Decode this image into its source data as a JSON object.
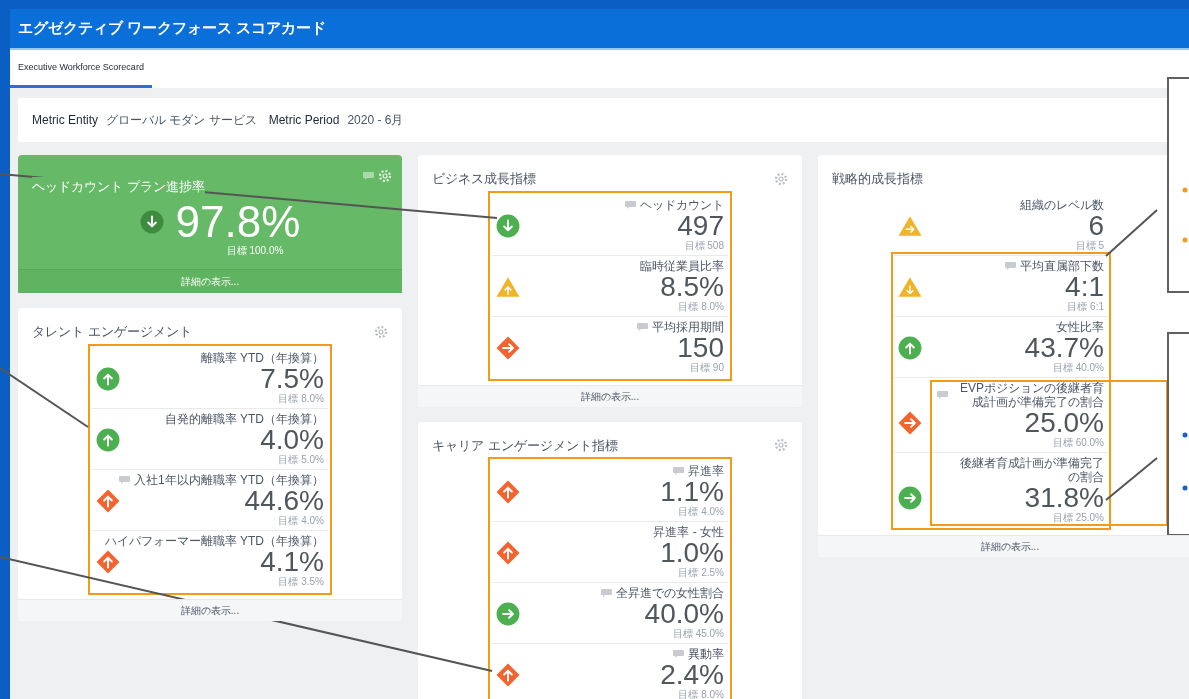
{
  "window": {
    "title": "エグゼクティブ ワークフォース スコアカード"
  },
  "tabs": [
    {
      "label": "Executive Workforce Scorecard",
      "selected": true
    }
  ],
  "filters": [
    {
      "label": "Metric Entity",
      "value": "グローバル モダン サービス"
    },
    {
      "label": "Metric Period",
      "value": "2020 - 6月"
    }
  ],
  "columns": [
    [
      {
        "kind": "highlight",
        "title": "ヘッドカウント プラン進捗率",
        "comment": true,
        "icon": {
          "kind": "circle",
          "color": "#3e8a3e"
        },
        "arrow": {
          "kind": "down"
        },
        "value": "97.8%",
        "target": "目標 100.0%",
        "link": "詳細の表示..."
      },
      {
        "kind": "list",
        "title": "タレント エンゲージメント",
        "link": "詳細の表示...",
        "metrics": [
          {
            "label": "離職率 YTD（年換算）",
            "comment": false,
            "icon": {
              "kind": "circle",
              "color": "#4caf50"
            },
            "arrow": {
              "kind": "up"
            },
            "value": "7.5%",
            "target": "目標 8.0%"
          },
          {
            "label": "自発的離職率 YTD（年換算）",
            "comment": false,
            "icon": {
              "kind": "circle",
              "color": "#4caf50"
            },
            "arrow": {
              "kind": "up"
            },
            "value": "4.0%",
            "target": "目標 5.0%"
          },
          {
            "label": "入社1年以内離職率 YTD（年換算）",
            "comment": true,
            "icon": {
              "kind": "diamond",
              "color": "#f4622e"
            },
            "arrow": {
              "kind": "up"
            },
            "value": "44.6%",
            "target": "目標 4.0%"
          },
          {
            "label": "ハイパフォーマー離職率 YTD（年換算）",
            "comment": false,
            "icon": {
              "kind": "diamond",
              "color": "#f4622e"
            },
            "arrow": {
              "kind": "up"
            },
            "value": "4.1%",
            "target": "目標 3.5%"
          }
        ]
      }
    ],
    [
      {
        "kind": "list",
        "title": "ビジネス成長指標",
        "link": "詳細の表示...",
        "metrics": [
          {
            "label": "ヘッドカウント",
            "comment": true,
            "icon": {
              "kind": "circle",
              "color": "#4caf50"
            },
            "arrow": {
              "kind": "down"
            },
            "value": "497",
            "target": "目標 508"
          },
          {
            "label": "臨時従業員比率",
            "comment": false,
            "icon": {
              "kind": "triangle",
              "color": "#f0b429"
            },
            "arrow": {
              "kind": "up"
            },
            "value": "8.5%",
            "target": "目標 8.0%"
          },
          {
            "label": "平均採用期間",
            "comment": true,
            "icon": {
              "kind": "diamond",
              "color": "#f4622e"
            },
            "arrow": {
              "kind": "right"
            },
            "value": "150",
            "target": "目標 90"
          }
        ]
      },
      {
        "kind": "list",
        "title": "キャリア エンゲージメント指標",
        "metrics": [
          {
            "label": "昇進率",
            "comment": true,
            "icon": {
              "kind": "diamond",
              "color": "#f4622e"
            },
            "arrow": {
              "kind": "up"
            },
            "value": "1.1%",
            "target": "目標 4.0%"
          },
          {
            "label": "昇進率 - 女性",
            "comment": false,
            "icon": {
              "kind": "diamond",
              "color": "#f4622e"
            },
            "arrow": {
              "kind": "up"
            },
            "value": "1.0%",
            "target": "目標 2.5%"
          },
          {
            "label": "全昇進での女性割合",
            "comment": true,
            "icon": {
              "kind": "circle",
              "color": "#4caf50"
            },
            "arrow": {
              "kind": "right"
            },
            "value": "40.0%",
            "target": "目標 45.0%"
          },
          {
            "label": "異動率",
            "comment": true,
            "icon": {
              "kind": "diamond",
              "color": "#f4622e"
            },
            "arrow": {
              "kind": "up"
            },
            "value": "2.4%",
            "target": "目標 8.0%"
          }
        ]
      }
    ],
    [
      {
        "kind": "list",
        "title": "戦略的成長指標",
        "link": "詳細の表示...",
        "metrics": [
          {
            "label": "組織のレベル数",
            "comment": false,
            "icon": {
              "kind": "triangle",
              "color": "#f0b429"
            },
            "arrow": {
              "kind": "right"
            },
            "value": "6",
            "target": "目標 5"
          },
          {
            "label": "平均直属部下数",
            "comment": true,
            "icon": {
              "kind": "triangle",
              "color": "#f0b429"
            },
            "arrow": {
              "kind": "down"
            },
            "value": "4:1",
            "target": "目標 6:1"
          },
          {
            "label": "女性比率",
            "comment": false,
            "icon": {
              "kind": "circle",
              "color": "#4caf50"
            },
            "arrow": {
              "kind": "up"
            },
            "value": "43.7%",
            "target": "目標 40.0%"
          },
          {
            "label": "EVPポジションの後継者育成計画が準備完了の割合",
            "comment": true,
            "icon": {
              "kind": "diamond",
              "color": "#f4622e"
            },
            "arrow": {
              "kind": "right"
            },
            "value": "25.0%",
            "target": "目標 60.0%"
          },
          {
            "label": "後継者育成計画が準備完了の割合",
            "comment": false,
            "icon": {
              "kind": "circle",
              "color": "#4caf50"
            },
            "arrow": {
              "kind": "right"
            },
            "value": "31.8%",
            "target": "目標 25.0%"
          }
        ]
      }
    ]
  ]
}
